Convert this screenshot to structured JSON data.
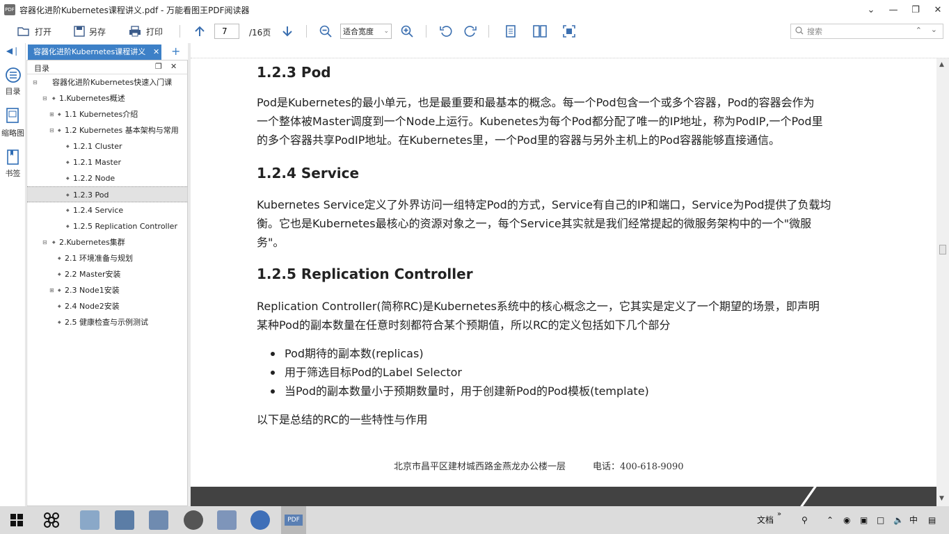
{
  "window": {
    "title": "容器化进阶Kubernetes课程讲义.pdf - 万能看图王PDF阅读器",
    "app_icon": "PDF",
    "buttons": [
      "chevron-down-icon",
      "minimize-icon",
      "restore-icon",
      "close-icon"
    ]
  },
  "toolbar": {
    "open_label": "打开",
    "saveas_label": "另存",
    "print_label": "打印",
    "current_page": "7",
    "total_pages": "/16页",
    "zoom_mode": "适合宽度",
    "search_placeholder": "搜索"
  },
  "leftstrip": {
    "outline_label": "目录",
    "thumbnails_label": "缩略图",
    "bookmarks_label": "书签"
  },
  "tabs": {
    "doc_tab_label": "容器化进阶Kubernetes课程讲义",
    "add_label": "+"
  },
  "outline": {
    "header": "目录",
    "items": [
      {
        "level": 0,
        "label": "容器化进阶Kubernetes快速入门课",
        "toggle": "⊟"
      },
      {
        "level": 1,
        "label": "1.Kubernetes概述",
        "toggle": "⊟"
      },
      {
        "level": 2,
        "label": "1.1 Kubernetes介绍",
        "toggle": "⊞"
      },
      {
        "level": 2,
        "label": "1.2 Kubernetes 基本架构与常用",
        "toggle": "⊟"
      },
      {
        "level": 3,
        "label": "1.2.1 Cluster",
        "toggle": ""
      },
      {
        "level": 3,
        "label": "1.2.1 Master",
        "toggle": ""
      },
      {
        "level": 3,
        "label": "1.2.2 Node",
        "toggle": ""
      },
      {
        "level": 3,
        "label": "1.2.3 Pod",
        "toggle": "",
        "selected": true
      },
      {
        "level": 3,
        "label": "1.2.4 Service",
        "toggle": ""
      },
      {
        "level": 3,
        "label": "1.2.5 Replication Controller",
        "toggle": ""
      },
      {
        "level": 1,
        "label": "2.Kubernetes集群",
        "toggle": "⊟"
      },
      {
        "level": 2,
        "label": "2.1 环境准备与规划",
        "toggle": ""
      },
      {
        "level": 2,
        "label": "2.2 Master安装",
        "toggle": ""
      },
      {
        "level": 2,
        "label": "2.3 Node1安装",
        "toggle": "⊞"
      },
      {
        "level": 2,
        "label": "2.4 Node2安装",
        "toggle": ""
      },
      {
        "level": 2,
        "label": "2.5 健康检查与示例测试",
        "toggle": ""
      }
    ]
  },
  "document": {
    "sections": [
      {
        "heading": "1.2.3 Pod",
        "lines": [
          "Pod是Kubernetes的最小单元，也是最重要和最基本的概念。每一个Pod包含一个或多个容器，Pod的容器会作为",
          "一个整体被Master调度到一个Node上运行。Kubenetes为每个Pod都分配了唯一的IP地址，称为PodIP,一个Pod里",
          "的多个容器共享PodIP地址。在Kubernetes里，一个Pod里的容器与另外主机上的Pod容器能够直接通信。"
        ]
      },
      {
        "heading": "1.2.4 Service",
        "lines": [
          "Kubernetes Service定义了外界访问一组特定Pod的方式，Service有自己的IP和端口，Service为Pod提供了负载均",
          "衡。它也是Kubernetes最核心的资源对象之一，每个Service其实就是我们经常提起的微服务架构中的一个\"微服",
          "务\"。"
        ]
      },
      {
        "heading": "1.2.5 Replication Controller",
        "lines": [
          "Replication Controller(简称RC)是Kubernetes系统中的核心概念之一，它其实是定义了一个期望的场景，即声明",
          "某种Pod的副本数量在任意时刻都符合某个预期值，所以RC的定义包括如下几个部分"
        ]
      }
    ],
    "bullets": [
      "Pod期待的副本数(replicas)",
      "用于筛选目标Pod的Label Selector",
      "当Pod的副本数量小于预期数量时，用于创建新Pod的Pod模板(template)"
    ],
    "summary_line": "以下是总结的RC的一些特性与作用",
    "footer": "北京市昌平区建材城西路金燕龙办公楼一层　　　电话：400-618-9090"
  },
  "taskbar": {
    "pdf_label": "PDF",
    "tray_docs": "文档",
    "ime": "中"
  }
}
